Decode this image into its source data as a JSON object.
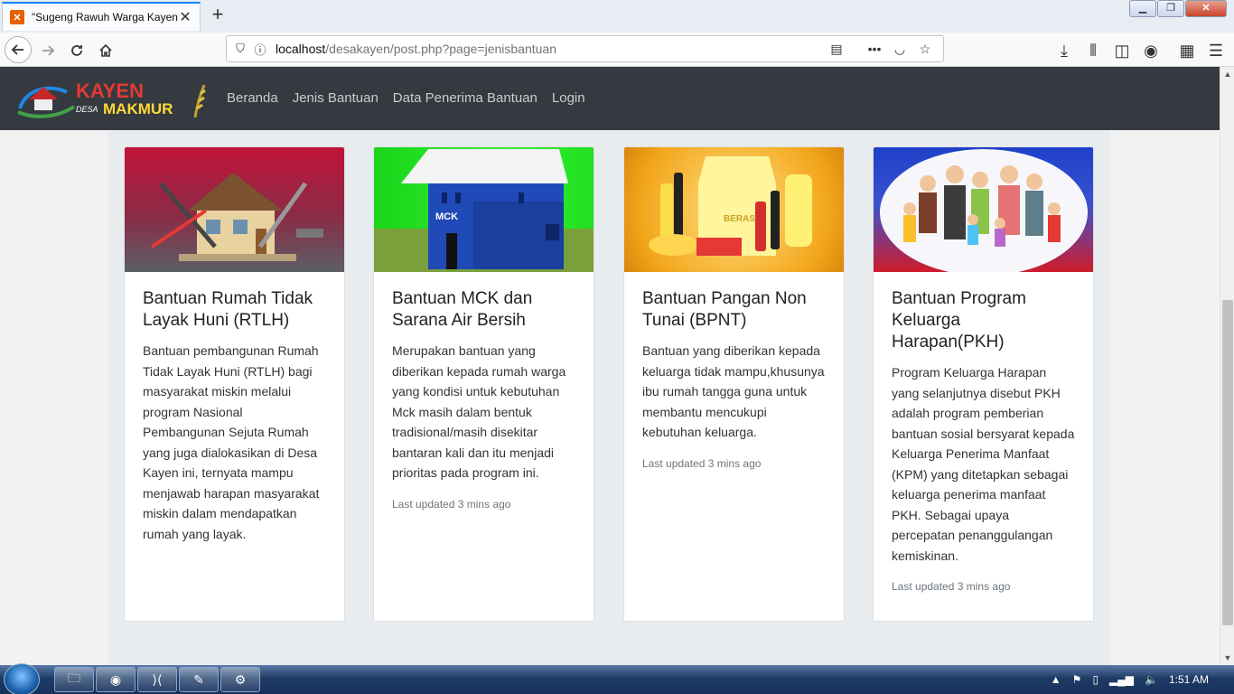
{
  "browser": {
    "tab_title": "\"Sugeng Rawuh Warga Kayen\"",
    "tab_close": "✕",
    "new_tab": "+",
    "url_host": "localhost",
    "url_path": "/desakayen/post.php?page=jenisbantuan"
  },
  "site": {
    "logo_text_top": "KAYEN",
    "logo_text_desa": "DESA",
    "logo_text_bottom": "MAKMUR",
    "menu": [
      "Beranda",
      "Jenis Bantuan",
      "Data Penerima Bantuan",
      "Login"
    ]
  },
  "cards": [
    {
      "title": "Bantuan Rumah Tidak Layak Huni (RTLH)",
      "text": "Bantuan pembangunan Rumah Tidak Layak Huni (RTLH) bagi masyarakat miskin melalui program Nasional Pembangunan Sejuta Rumah yang juga dialokasikan di Desa Kayen ini, ternyata mampu menjawab harapan masyarakat miskin dalam mendapatkan rumah yang layak.",
      "footer": ""
    },
    {
      "title": "Bantuan MCK dan Sarana Air Bersih",
      "text": "Merupakan bantuan yang diberikan kepada rumah warga yang kondisi untuk kebutuhan Mck masih dalam bentuk tradisional/masih disekitar bantaran kali dan itu menjadi prioritas pada program ini.",
      "footer": "Last updated 3 mins ago",
      "image_label": "MCK"
    },
    {
      "title": "Bantuan Pangan Non Tunai (BPNT)",
      "text": "Bantuan yang diberikan kepada keluarga tidak mampu,khusunya ibu rumah tangga guna untuk membantu mencukupi kebutuhan keluarga.",
      "footer": "Last updated 3 mins ago",
      "image_label": "BERAS"
    },
    {
      "title": "Bantuan Program Keluarga Harapan(PKH)",
      "text": "Program Keluarga Harapan yang selanjutnya disebut PKH adalah program pemberian bantuan sosial bersyarat kepada Keluarga Penerima Manfaat (KPM) yang ditetapkan sebagai keluarga penerima manfaat PKH. Sebagai upaya percepatan penanggulangan kemiskinan.",
      "footer": "Last updated 3 mins ago"
    }
  ],
  "taskbar": {
    "clock": "1:51 AM"
  }
}
